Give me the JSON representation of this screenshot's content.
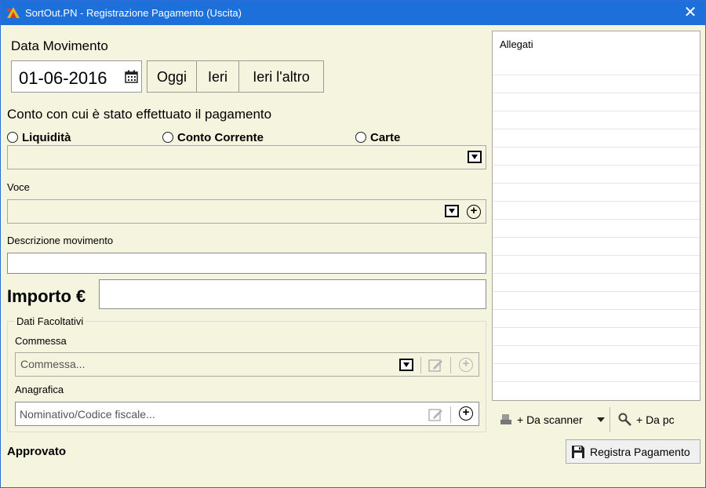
{
  "window": {
    "title": "SortOut.PN - Registrazione Pagamento (Uscita)",
    "close_glyph": "✕"
  },
  "date": {
    "label": "Data Movimento",
    "value": "01-06-2016",
    "quick": [
      "Oggi",
      "Ieri",
      "Ieri l'altro"
    ]
  },
  "account": {
    "label": "Conto con cui è stato effettuato il pagamento",
    "options": [
      "Liquidità",
      "Conto Corrente",
      "Carte"
    ]
  },
  "voce": {
    "label": "Voce"
  },
  "descrizione": {
    "label": "Descrizione movimento",
    "value": ""
  },
  "importo": {
    "label": "Importo €",
    "value": ""
  },
  "optional": {
    "legend": "Dati Facoltativi",
    "commessa_label": "Commessa",
    "commessa_placeholder": "Commessa...",
    "anagrafica_label": "Anagrafica",
    "anagrafica_placeholder": "Nominativo/Codice fiscale..."
  },
  "status": {
    "approved_label": "Approvato"
  },
  "attachments": {
    "header": "Allegati",
    "scanner_label": "+ Da scanner",
    "pc_label": "+ Da pc"
  },
  "actions": {
    "submit_label": "Registra Pagamento"
  },
  "colors": {
    "titlebar": "#1d70da",
    "form_bg": "#f4f4df",
    "accent_border": "#2b6cd6"
  }
}
